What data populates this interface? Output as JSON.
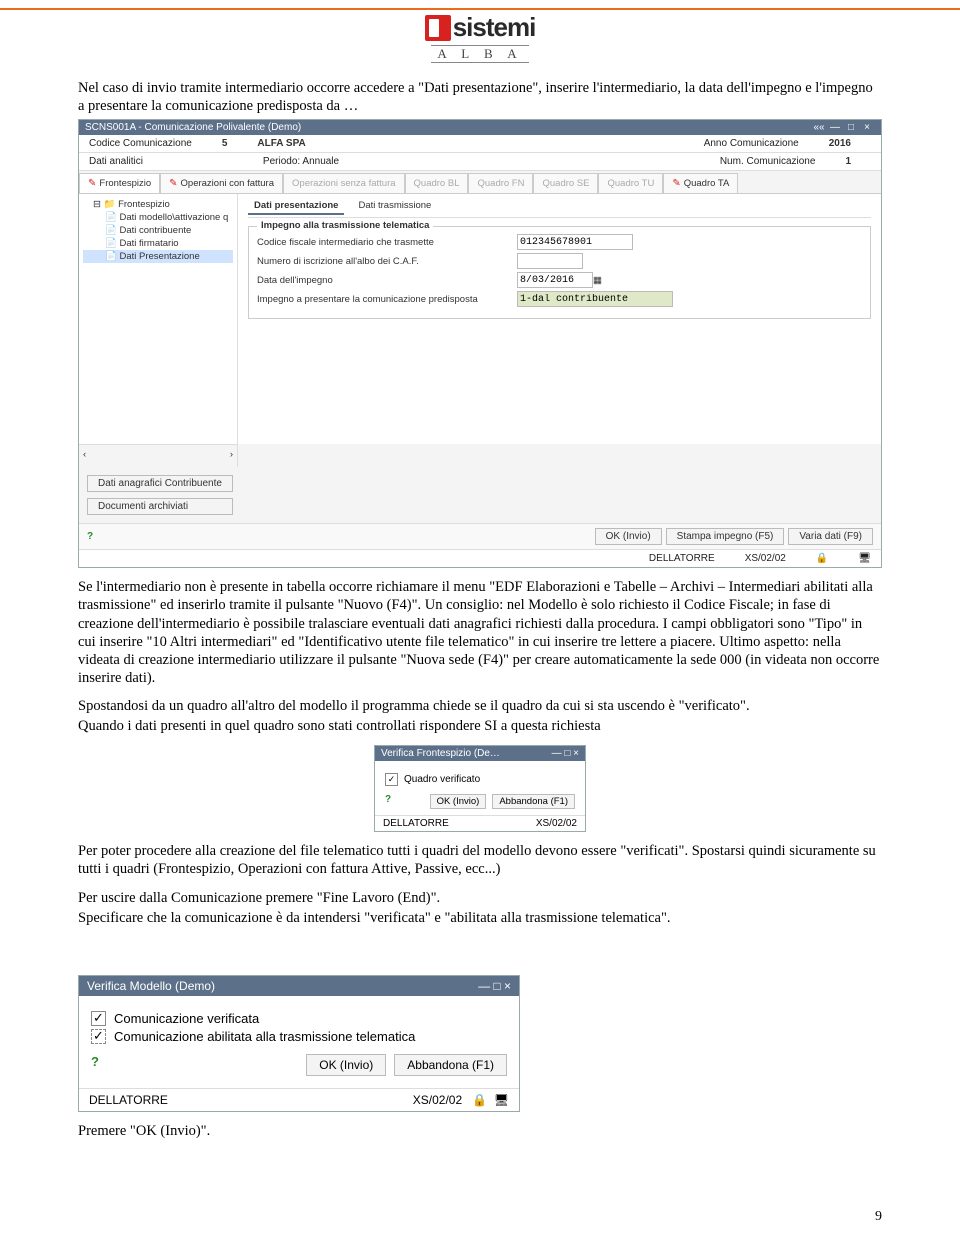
{
  "logo": {
    "brand": "sistemi",
    "sub": "A L B A"
  },
  "para1": "Nel caso di invio tramite intermediario occorre accedere a \"Dati presentazione\", inserire l'intermediario, la data dell'impegno e l'impegno a presentare la comunicazione predisposta da …",
  "win1": {
    "title": "SCNS001A - Comunicazione Polivalente  (Demo)",
    "hdr": {
      "codice_lab": "Codice Comunicazione",
      "codice_val_n": "5",
      "codice_val_t": "ALFA SPA",
      "anno_lab": "Anno Comunicazione",
      "anno_val": "2016",
      "dati_lab": "Dati analitici",
      "periodo_lab": "Periodo: Annuale",
      "num_lab": "Num. Comunicazione",
      "num_val": "1"
    },
    "tabs": [
      "Frontespizio",
      "Operazioni con fattura",
      "Operazioni senza fattura",
      "Quadro BL",
      "Quadro FN",
      "Quadro SE",
      "Quadro TU",
      "Quadro TA"
    ],
    "tree": [
      "Frontespizio",
      "Dati modello\\attivazione q",
      "Dati contribuente",
      "Dati firmatario",
      "Dati Presentazione"
    ],
    "subtabs": [
      "Dati presentazione",
      "Dati trasmissione"
    ],
    "group_title": "Impegno alla trasmissione telematica",
    "fields": {
      "cf_lab": "Codice fiscale intermediario che trasmette",
      "cf_val": "012345678901",
      "albo_lab": "Numero di iscrizione all'albo dei C.A.F.",
      "data_lab": "Data dell'impegno",
      "data_val": "8/03/2016",
      "imp_lab": "Impegno a presentare la comunicazione predisposta",
      "imp_val": "1-dal contribuente"
    },
    "side_btns": [
      "Dati anagrafici Contribuente",
      "Documenti archiviati"
    ],
    "bottom_btns": [
      "OK (Invio)",
      "Stampa impegno (F5)",
      "Varia dati (F9)"
    ],
    "status_user": "DELLATORRE",
    "status_code": "XS/02/02"
  },
  "para2": "Se l'intermediario non è presente in tabella occorre richiamare il menu \"EDF Elaborazioni e Tabelle – Archivi – Intermediari abilitati alla trasmissione\" ed inserirlo tramite il pulsante \"Nuovo (F4)\". Un consiglio: nel Modello è solo richiesto il Codice Fiscale; in fase di creazione dell'intermediario è possibile tralasciare eventuali dati anagrafici richiesti dalla procedura. I campi obbligatori sono \"Tipo\" in cui inserire \"10 Altri intermediari\" ed \"Identificativo utente file telematico\" in cui inserire tre lettere a piacere. Ultimo aspetto: nella videata di creazione intermediario utilizzare il pulsante \"Nuova sede (F4)\" per creare automaticamente la sede 000 (in videata non occorre inserire dati).",
  "para3a": "Spostandosi da un quadro all'altro del modello il programma chiede se il quadro da cui si sta uscendo è \"verificato\".",
  "para3b": "Quando i dati presenti in quel quadro sono stati controllati rispondere SI a questa richiesta",
  "dlg1": {
    "title": "Verifica Frontespizio (De…",
    "chk": "Quadro verificato",
    "ok": "OK (Invio)",
    "ab": "Abbandona (F1)",
    "user": "DELLATORRE",
    "code": "XS/02/02"
  },
  "para4": "Per poter procedere alla creazione del file telematico tutti i quadri del modello devono essere \"verificati\". Spostarsi quindi sicuramente su tutti i quadri (Frontespizio, Operazioni con fattura Attive, Passive, ecc...)",
  "para5": "Per uscire dalla Comunicazione premere \"Fine Lavoro (End)\".",
  "para6": "Specificare che la comunicazione è da intendersi \"verificata\" e \"abilitata alla trasmissione telematica\".",
  "dlg2": {
    "title": "Verifica Modello  (Demo)",
    "chk1": "Comunicazione verificata",
    "chk2": "Comunicazione abilitata alla trasmissione telematica",
    "ok": "OK (Invio)",
    "ab": "Abbandona (F1)",
    "user": "DELLATORRE",
    "code": "XS/02/02"
  },
  "para7": "Premere \"OK (Invio)\".",
  "pagenum": "9"
}
